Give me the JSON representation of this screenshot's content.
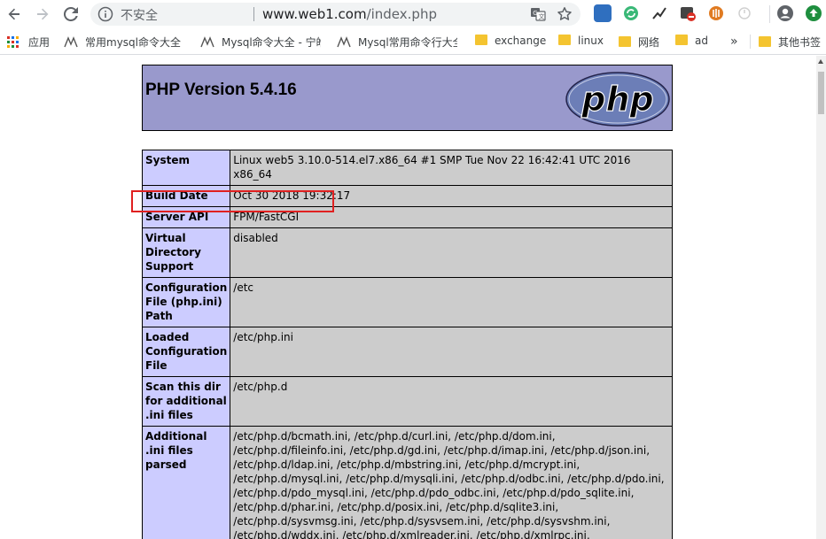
{
  "browser": {
    "omnibox": {
      "security_label": "不安全",
      "url_host": "www.web1.com",
      "url_path": "/index.php"
    },
    "bookmarks": [
      {
        "label": "应用",
        "icon": "apps-grid-icon"
      },
      {
        "label": "常用mysql命令大全",
        "icon": "bookmark-page-icon"
      },
      {
        "label": "Mysql命令大全 - 宁皓",
        "icon": "bookmark-page-icon"
      },
      {
        "label": "Mysql常用命令行大全",
        "icon": "bookmark-page-icon"
      },
      {
        "label": "exchange",
        "icon": "folder-icon"
      },
      {
        "label": "linux",
        "icon": "folder-icon"
      },
      {
        "label": "网络",
        "icon": "folder-icon"
      },
      {
        "label": "ad",
        "icon": "folder-icon"
      },
      {
        "label": "»",
        "icon": "overflow-icon"
      },
      {
        "label": "其他书签",
        "icon": "folder-icon"
      }
    ]
  },
  "page": {
    "header_title": "PHP Version 5.4.16",
    "logo_text": "php",
    "rows": [
      {
        "key": "System",
        "value": "Linux web5 3.10.0-514.el7.x86_64 #1 SMP Tue Nov 22 16:42:41 UTC 2016 x86_64"
      },
      {
        "key": "Build Date",
        "value": "Oct 30 2018 19:32:17"
      },
      {
        "key": "Server API",
        "value": "FPM/FastCGI"
      },
      {
        "key": "Virtual Directory Support",
        "value": "disabled"
      },
      {
        "key": "Configuration File (php.ini) Path",
        "value": "/etc"
      },
      {
        "key": "Loaded Configuration File",
        "value": "/etc/php.ini"
      },
      {
        "key": "Scan this dir for additional .ini files",
        "value": "/etc/php.d"
      },
      {
        "key": "Additional .ini files parsed",
        "value": "/etc/php.d/bcmath.ini, /etc/php.d/curl.ini, /etc/php.d/dom.ini, /etc/php.d/fileinfo.ini, /etc/php.d/gd.ini, /etc/php.d/imap.ini, /etc/php.d/json.ini, /etc/php.d/ldap.ini, /etc/php.d/mbstring.ini, /etc/php.d/mcrypt.ini, /etc/php.d/mysql.ini, /etc/php.d/mysqli.ini, /etc/php.d/odbc.ini, /etc/php.d/pdo.ini, /etc/php.d/pdo_mysql.ini, /etc/php.d/pdo_odbc.ini, /etc/php.d/pdo_sqlite.ini, /etc/php.d/phar.ini, /etc/php.d/posix.ini, /etc/php.d/sqlite3.ini, /etc/php.d/sysvmsg.ini, /etc/php.d/sysvsem.ini, /etc/php.d/sysvshm.ini, /etc/php.d/wddx.ini, /etc/php.d/xmlreader.ini, /etc/php.d/xmlrpc.ini, /etc/php.d/xmlwriter.ini, /etc/php.d/xsl.ini, /etc/php.d/zip.ini"
      }
    ]
  },
  "colors": {
    "header_bg": "#9999cc",
    "key_bg": "#ccccff",
    "value_bg": "#cccccc",
    "highlight": "#e02020"
  }
}
